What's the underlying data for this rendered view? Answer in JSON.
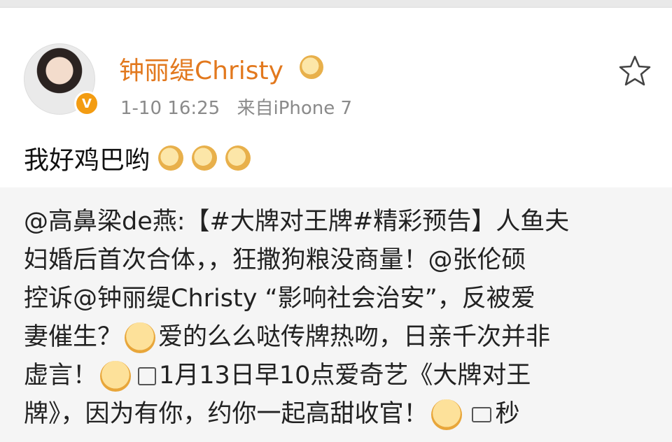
{
  "post": {
    "username": "钟丽缇Christy",
    "timestamp": "1-10 16:25",
    "source": "来自iPhone 7",
    "text": "我好鸡巴哟",
    "text_emojis": [
      "ok-hand-emoji",
      "ok-hand-emoji",
      "ok-hand-emoji"
    ],
    "verified_badge": "V"
  },
  "repost": {
    "lines": [
      "@高鼻梁de燕:【#大牌对王牌#精彩预告】人鱼夫",
      "妇婚后首次合体，，狂撒狗粮没商量！@张伦硕",
      "控诉@钟丽缇Christy “影响社会治安”，反被爱",
      [
        "妻催生？",
        "爱的么么哒传牌热吻，日亲千次并非"
      ],
      [
        "虚言！",
        "1月13日早10点爱奇艺《大牌对王"
      ],
      [
        "牌》，因为有你，约你一起高甜收官！",
        "秒"
      ]
    ]
  },
  "colors": {
    "username": "#e2781d",
    "meta": "#8a8a8a",
    "repost_bg": "#f5f5f5"
  }
}
